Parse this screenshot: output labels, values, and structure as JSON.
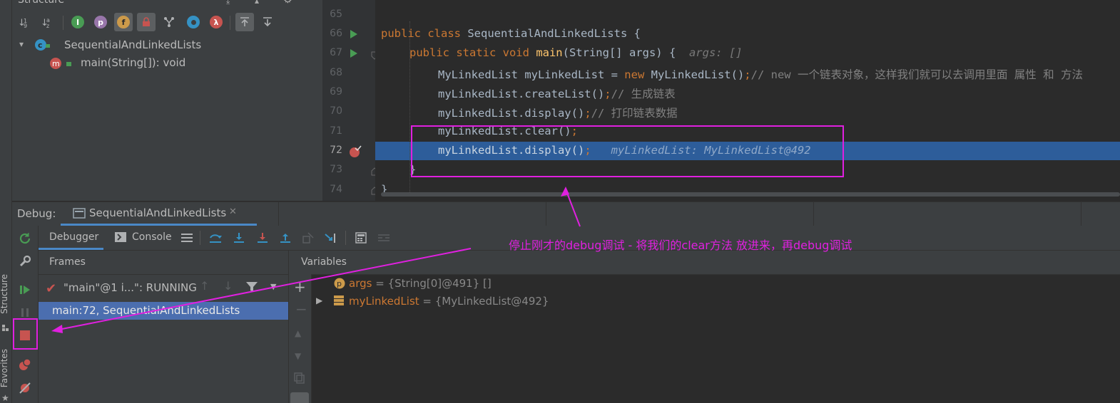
{
  "structure": {
    "title": "Structure",
    "toolbar_icons": [
      "sort-by-type-icon",
      "sort-alphabetically-icon",
      "show-inherited-icon",
      "show-properties-icon",
      "show-fields-icon",
      "show-non-public-icon",
      "show-anonymous-icon",
      "show-lambdas-icon-circle",
      "show-lambdas-icon"
    ],
    "tree": {
      "class_name": "SequentialAndLinkedLists",
      "method": "main(String[]): void"
    }
  },
  "editor": {
    "line_numbers": [
      "65",
      "66",
      "67",
      "68",
      "69",
      "70",
      "71",
      "72",
      "73",
      "74"
    ],
    "lines": {
      "l66": {
        "kw": "public class ",
        "name": "SequentialAndLinkedLists",
        "rest": " {"
      },
      "l67": {
        "kw": "public static void ",
        "fn": "main",
        "args": "(String[] args) {",
        "hint": "args: []"
      },
      "l68": {
        "a": "MyLinkedList myLinkedList = ",
        "kw": "new",
        "b": " MyLinkedList()",
        "semi": ";",
        "cm": "// new 一个链表对象，这样我们就可以去调用里面 属性 和 方法"
      },
      "l69": {
        "a": "myLinkedList.createList()",
        "semi": ";",
        "cm": "// 生成链表"
      },
      "l70": {
        "a": "myLinkedList.display()",
        "semi": ";",
        "cm": "// 打印链表数据"
      },
      "l71": {
        "a": "myLinkedList.clear()",
        "semi": ";"
      },
      "l72": {
        "a": "myLinkedList.display()",
        "semi": ";",
        "hint": "myLinkedList: MyLinkedList@492"
      },
      "l73": {
        "a": "}"
      },
      "l74": {
        "a": "}"
      }
    }
  },
  "debug": {
    "label": "Debug:",
    "session": "SequentialAndLinkedLists",
    "tabs": {
      "debugger": "Debugger",
      "console": "Console"
    },
    "frames_header": "Frames",
    "variables_header": "Variables",
    "thread": "\"main\"@1 i...\": RUNNING",
    "frame": "main:72, SequentialAndLinkedLists",
    "variables": [
      {
        "badge": "p",
        "name": "args",
        "value": " = {String[0]@491} []"
      },
      {
        "badge": "≡",
        "name": "myLinkedList",
        "value": " = {MyLinkedList@492}"
      }
    ]
  },
  "annotation": {
    "text": "停止刚才的debug调试 - 将我们的clear方法 放进来，再debug调试",
    "color": "#e020e0"
  },
  "side_tabs": {
    "structure": "Structure",
    "favorites": "Favorites"
  },
  "colors": {
    "selection": "#2d5d9a",
    "keyword": "#cc7832",
    "function": "#ffc66d",
    "comment": "#808080",
    "stop": "#c75450",
    "run": "#499c54"
  }
}
